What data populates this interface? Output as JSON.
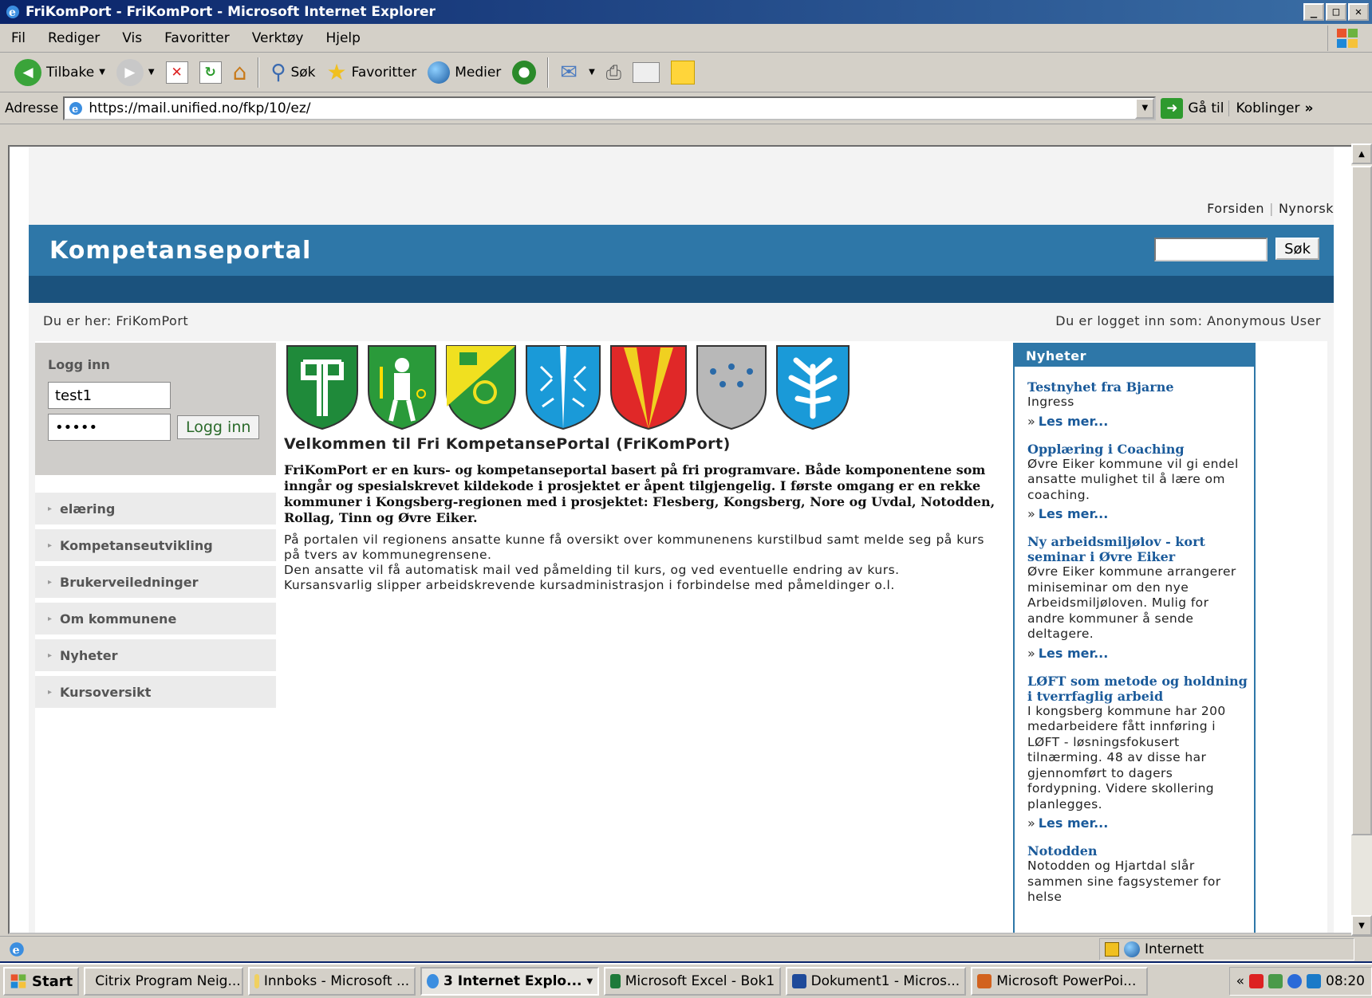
{
  "window": {
    "title": "FriKomPort - FriKomPort - Microsoft Internet Explorer"
  },
  "menubar": [
    "Fil",
    "Rediger",
    "Vis",
    "Favoritter",
    "Verktøy",
    "Hjelp"
  ],
  "toolbar": {
    "back": "Tilbake",
    "search": "Søk",
    "favorites": "Favoritter",
    "media": "Medier"
  },
  "address": {
    "label": "Adresse",
    "url": "https://mail.unified.no/fkp/10/ez/",
    "goto": "Gå til",
    "links": "Koblinger"
  },
  "page": {
    "toplinks": {
      "home": "Forsiden",
      "lang": "Nynorsk"
    },
    "banner_title": "Kompetanseportal",
    "search_button": "Søk",
    "breadcrumb": "Du er her: FriKomPort",
    "logged_in": "Du er logget inn som: Anonymous User",
    "login": {
      "title": "Logg inn",
      "username": "test1",
      "password": "•••••",
      "button": "Logg inn"
    },
    "menu": [
      "elæring",
      "Kompetanseutvikling",
      "Brukerveiledninger",
      "Om kommunene",
      "Nyheter",
      "Kursoversikt"
    ],
    "welcome": "Velkommen til Fri KompetansePortal (FriKomPort)",
    "intro": "FriKomPort er en kurs- og kompetanseportal basert på fri programvare. Både komponentene som inngår og spesialskrevet kildekode i prosjektet er åpent tilgjengelig. I første omgang er en rekke kommuner i Kongsberg-regionen med i prosjektet: Flesberg, Kongsberg, Nore og Uvdal, Notodden, Rollag, Tinn og Øvre Eiker.",
    "body1": "På portalen vil regionens ansatte kunne få oversikt over kommunenens kurstilbud samt melde seg på kurs på tvers av kommunegrensene.",
    "body2": "Den ansatte vil få automatisk mail ved påmelding til kurs, og ved eventuelle endring av kurs.",
    "body3": "Kursansvarlig slipper arbeidskrevende kursadministrasjon i forbindelse med påmeldinger o.l.",
    "news_heading": "Nyheter",
    "read_more": "Les mer...",
    "news": [
      {
        "title": "Testnyhet fra Bjarne",
        "ingress": "Ingress"
      },
      {
        "title": "Opplæring i Coaching",
        "ingress": "Øvre Eiker kommune vil gi endel ansatte mulighet til å lære om coaching."
      },
      {
        "title": "Ny arbeidsmiljølov - kort seminar i Øvre Eiker",
        "ingress": "Øvre Eiker kommune arrangerer miniseminar om den nye Arbeidsmiljøloven. Mulig for andre kommuner å sende deltagere."
      },
      {
        "title": "LØFT som metode og holdning i tverrfaglig arbeid",
        "ingress": "I kongsberg kommune har 200 medarbeidere fått innføring i LØFT - løsningsfokusert tilnærming. 48 av disse har gjennomført to dagers fordypning. Videre skollering planlegges."
      },
      {
        "title": "Notodden",
        "ingress": "Notodden og Hjartdal slår sammen sine fagsystemer for helse"
      }
    ]
  },
  "status": {
    "zone": "Internett"
  },
  "taskbar": {
    "start": "Start",
    "tasks": [
      "Citrix Program Neig...",
      "Innboks - Microsoft ...",
      "3 Internet Explo...",
      "Microsoft Excel - Bok1",
      "Dokument1 - Micros...",
      "Microsoft PowerPoi..."
    ],
    "clock": "08:20"
  },
  "colors": {
    "banner": "#2e77a8",
    "navstrip": "#1b527d",
    "link": "#1a5a9a"
  }
}
